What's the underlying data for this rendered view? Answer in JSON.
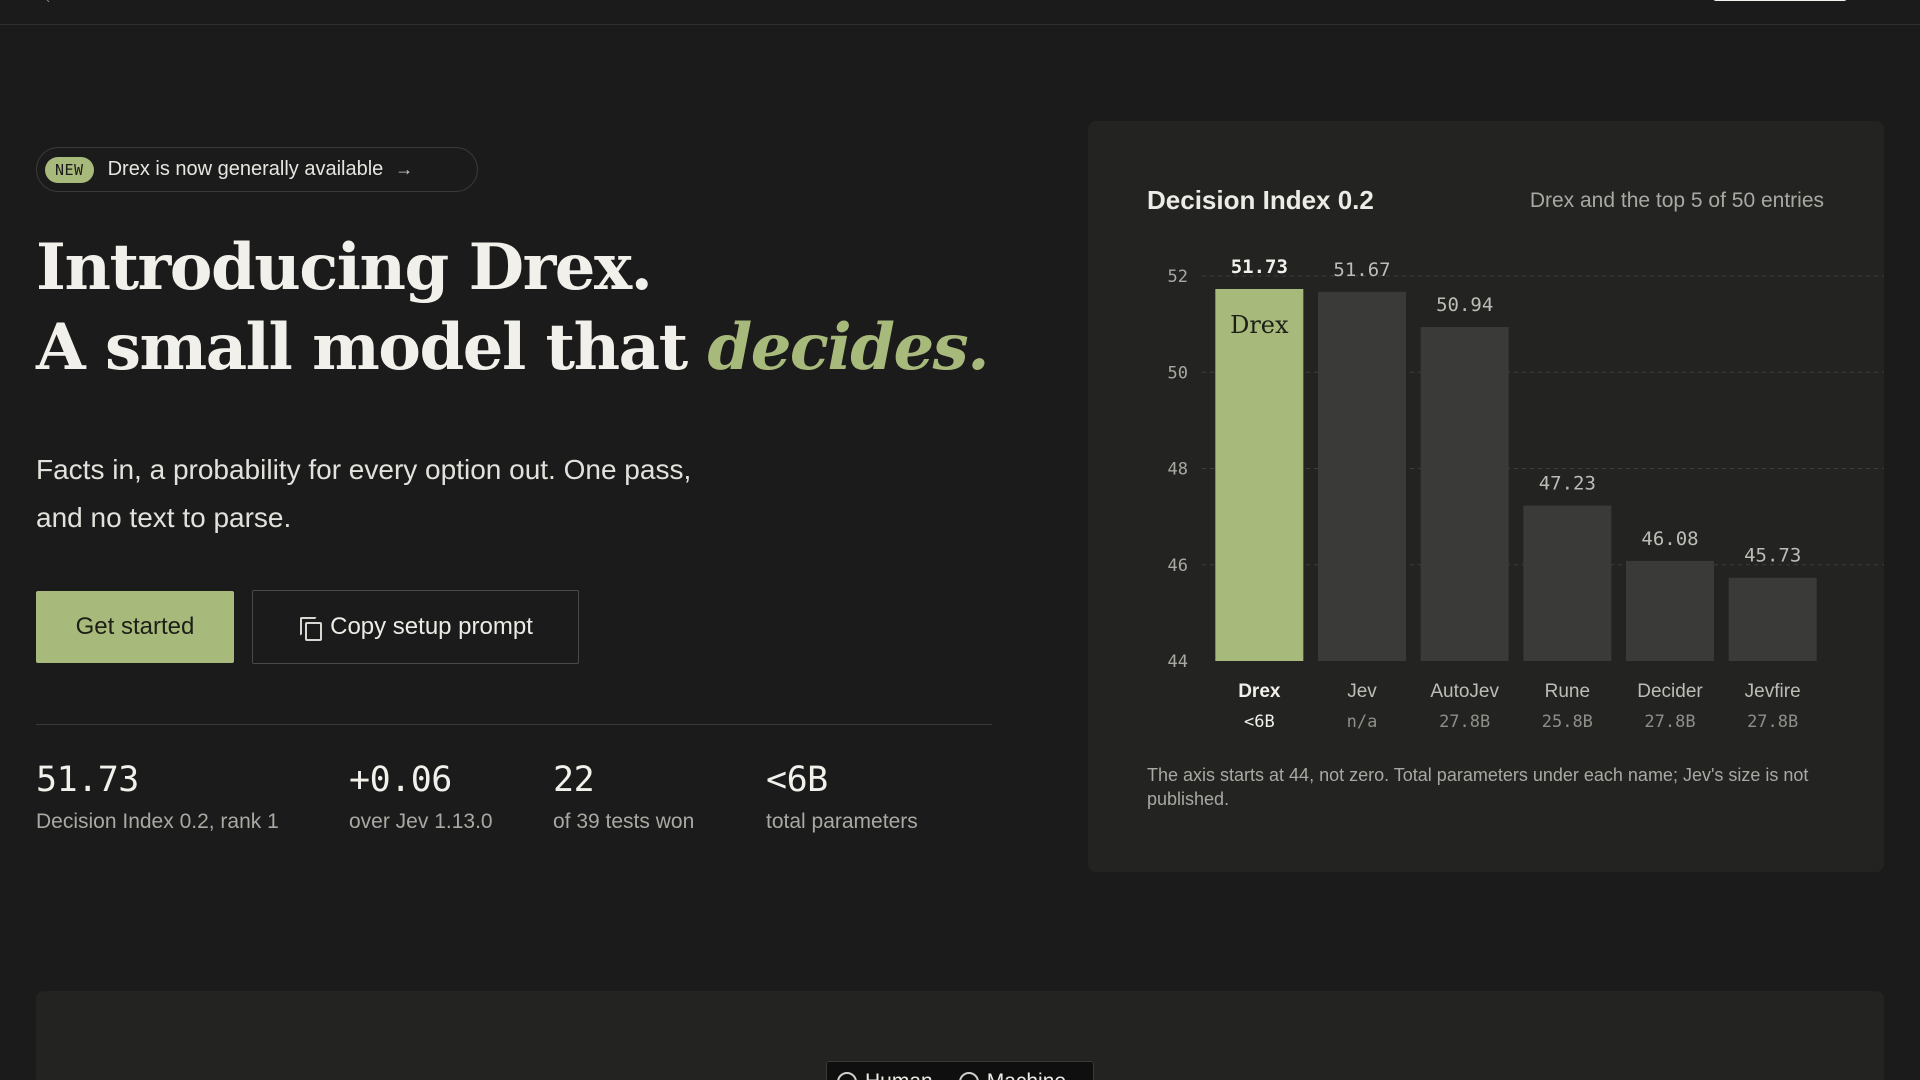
{
  "hero": {
    "badge": "NEW",
    "announcement": "Drex is now generally available",
    "announcement_arrow": "→",
    "headline_line1": "Introducing Drex.",
    "headline_line2_prefix": "A small model that ",
    "headline_line2_accent": "decides.",
    "subhead": "Facts in, a probability for every option out. One pass, and no text to parse.",
    "primary_cta": "Get started",
    "secondary_cta": "Copy setup prompt"
  },
  "stats": [
    {
      "value": "51.73",
      "label": "Decision Index 0.2, rank 1"
    },
    {
      "value": "+0.06",
      "label": "over Jev 1.13.0"
    },
    {
      "value": "22",
      "label": "of 39 tests won"
    },
    {
      "value": "<6B",
      "label": "total parameters"
    }
  ],
  "card": {
    "title": "Decision Index 0.2",
    "subtitle": "Drex and the top 5 of 50 entries",
    "note": "The axis starts at 44, not zero. Total parameters under each name; Jev's size is not published."
  },
  "chart_data": {
    "type": "bar",
    "title": "Decision Index 0.2",
    "subtitle": "Drex and the top 5 of 50 entries",
    "categories": [
      "Drex",
      "Jev",
      "AutoJev",
      "Rune",
      "Decider",
      "Jevfire"
    ],
    "sizes": [
      "<6B",
      "n/a",
      "27.8B",
      "25.8B",
      "27.8B",
      "27.8B"
    ],
    "values": [
      51.73,
      51.67,
      50.94,
      47.23,
      46.08,
      45.73
    ],
    "value_labels": [
      "51.73",
      "51.67",
      "50.94",
      "47.23",
      "46.08",
      "45.73"
    ],
    "in_bar_label": "Drex",
    "ylim": [
      44,
      52
    ],
    "yticks": [
      44,
      46,
      48,
      50,
      52
    ],
    "grid": true,
    "highlight_index": 0,
    "colors": {
      "highlight": "#a8ba7b",
      "bar": "#3a3a38",
      "grid": "#3c3c3a"
    }
  },
  "bottom": {
    "options": [
      "Human",
      "Machine"
    ]
  },
  "colors": {
    "background": "#1b1b1b",
    "accent": "#a8ba7b",
    "card": "#232322"
  }
}
